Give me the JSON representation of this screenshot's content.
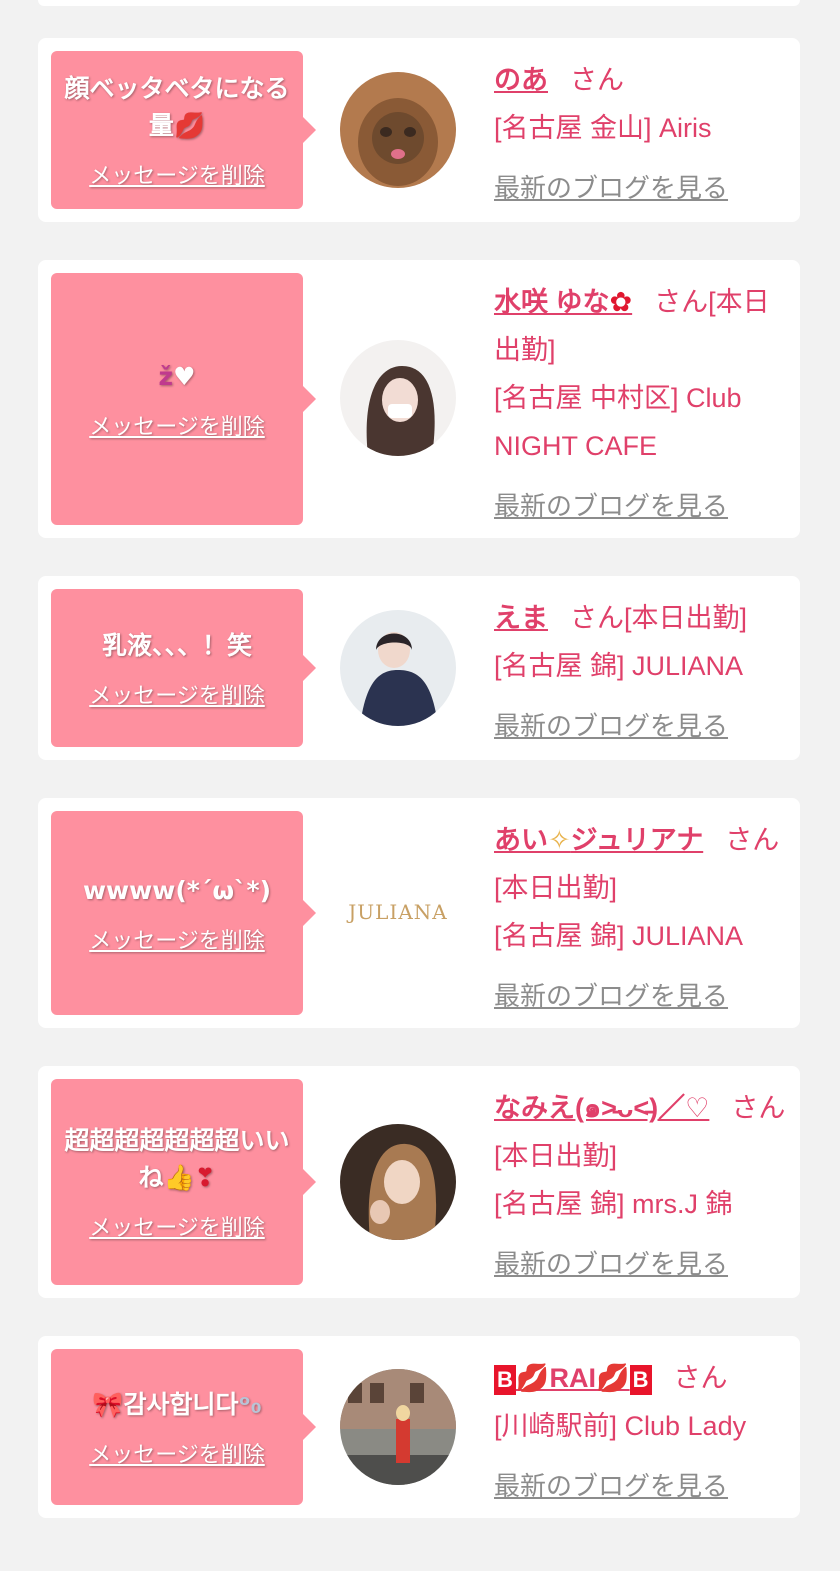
{
  "delete_label": "メッセージを削除",
  "blog_label": "最新のブログを見る",
  "honorific": "さん",
  "cards": [
    {
      "message": "顔ベッタベタになる量",
      "message_icon": "kiss-icon",
      "name": "のあ",
      "status": "",
      "shop": "[名古屋 金山] Airis",
      "avatar": "cat-photo"
    },
    {
      "message": "",
      "message_icons": [
        "sparkle-icon",
        "white-heart-icon"
      ],
      "name": "水咲 ゆな",
      "name_icon": "flower-icon",
      "status": "[本日出勤]",
      "shop": "[名古屋 中村区] Club NIGHT CAFE",
      "avatar": "woman-photo"
    },
    {
      "message": "乳液、、、！笑",
      "name": "えま",
      "status": "[本日出勤]",
      "shop": "[名古屋 錦] JULIANA",
      "avatar": "woman-photo"
    },
    {
      "message": "wwww(*´ω`*)",
      "name": "あい",
      "name_icon": "sparkles-icon",
      "name_suffix": "ジュリアナ",
      "status": "[本日出勤]",
      "shop": "[名古屋 錦] JULIANA",
      "avatar": "juliana-logo",
      "logo_text": "JULIANA"
    },
    {
      "message": "超超超超超超超いいね",
      "message_icons": [
        "thumbs-up-icon",
        "heart-exclamation-icon"
      ],
      "name": "なみえ(๑˃̵ᴗ˂̵)／♡",
      "status": "[本日出勤]",
      "shop": "[名古屋 錦] mrs.J 錦",
      "avatar": "woman-photo"
    },
    {
      "message": "감사합니다",
      "message_icons": [
        "ribbon-icon",
        "bubbles-icon"
      ],
      "name": "RAI",
      "name_prefix": "B",
      "name_postfix": "B",
      "status": "",
      "shop": "[川崎駅前] Club Lady",
      "avatar": "street-photo"
    }
  ],
  "colors": {
    "page_bg": "#f2f2f2",
    "card_bg": "#ffffff",
    "bubble": "#fe909f",
    "accent": "#e0406a",
    "link_gray": "#8c8c8c"
  }
}
